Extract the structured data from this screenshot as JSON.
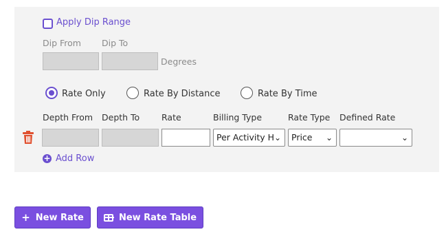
{
  "dip": {
    "apply_label": "Apply Dip Range",
    "from_label": "Dip From",
    "to_label": "Dip To",
    "unit": "Degrees"
  },
  "rate_mode": {
    "options": [
      "Rate Only",
      "Rate By Distance",
      "Rate By Time"
    ],
    "selected": "Rate Only"
  },
  "table": {
    "columns": [
      "Depth From",
      "Depth To",
      "Rate",
      "Billing Type",
      "Rate Type",
      "Defined Rate"
    ],
    "row": {
      "rate": "",
      "billing_type": "Per Activity H",
      "rate_type": "Price",
      "defined_rate": ""
    }
  },
  "add_row_label": "Add Row",
  "buttons": {
    "new_rate": "New Rate",
    "new_rate_table": "New Rate Table"
  },
  "colors": {
    "accent": "#6a4fcf",
    "button": "#7a4fe0",
    "delete": "#e0502f"
  }
}
